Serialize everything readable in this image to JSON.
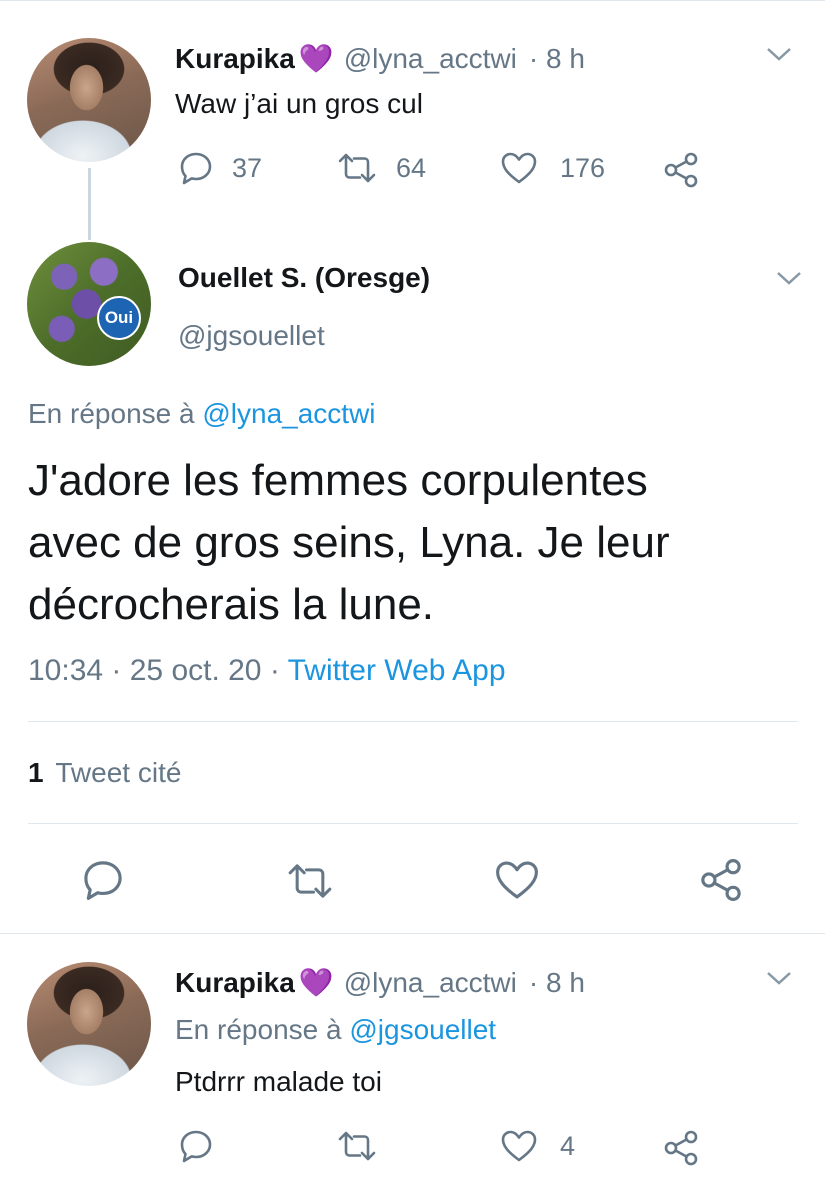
{
  "tweet1": {
    "name": "Kurapika",
    "name_badge": "💜",
    "handle": "@lyna_acctwi",
    "time": "· 8 h",
    "text": "Waw j’ai un gros cul",
    "replies": "37",
    "retweets": "64",
    "likes": "176"
  },
  "main_tweet": {
    "name": "Ouellet S. (Oresge)",
    "handle": "@jgsouellet",
    "avatar_badge": "Oui",
    "reply_prefix": "En réponse à",
    "reply_to": "@lyna_acctwi",
    "text_lines": [
      "J'adore les femmes corpulentes",
      "avec de gros seins, Lyna. Je leur",
      "décrocherais la lune."
    ],
    "timestamp": "10:34 · 25 oct. 20 · ",
    "source": "Twitter Web App",
    "quote_count": "1",
    "quote_label": "Tweet cité"
  },
  "tweet3": {
    "name": "Kurapika",
    "name_badge": "💜",
    "handle": "@lyna_acctwi",
    "time": "· 8 h",
    "reply_prefix": "En réponse à",
    "reply_to": "@jgsouellet",
    "text": "Ptdrrr malade toi",
    "likes": "4"
  },
  "colors": {
    "link": "#1b95e0",
    "secondary_text": "#657786",
    "badge_heart": "#b497e6",
    "divider": "#e1e8ed"
  }
}
